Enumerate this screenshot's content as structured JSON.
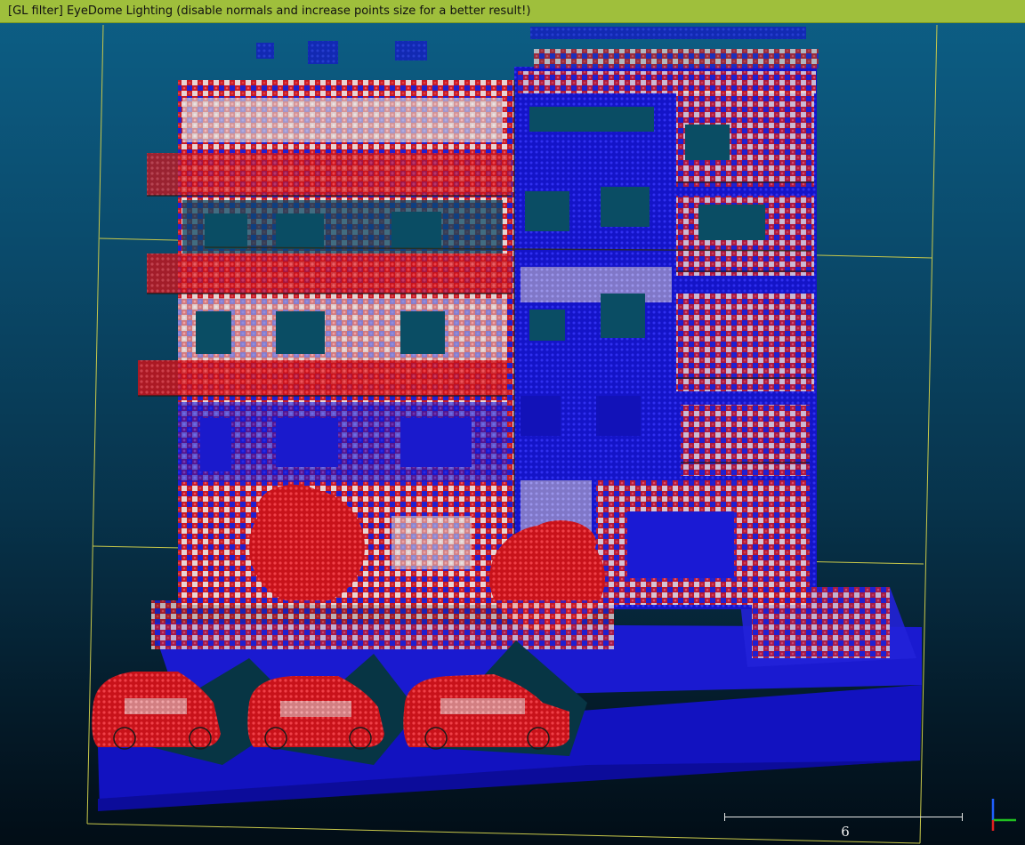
{
  "banner": {
    "text": "[GL filter] EyeDome Lighting (disable normals and increase points size for a better result!)"
  },
  "scale": {
    "label": "6"
  },
  "colors": {
    "banner_bg": "#9fbf3c",
    "bbox_line": "#c8c84a",
    "points_red": "#d8141b",
    "points_blue": "#1818d8",
    "points_white": "#e8d8d8",
    "shadow": "#073544",
    "axis_x": "#e02020",
    "axis_y": "#20c020",
    "axis_z": "#2060ff"
  },
  "icons": {
    "axis": "axis-trihedron-icon"
  }
}
